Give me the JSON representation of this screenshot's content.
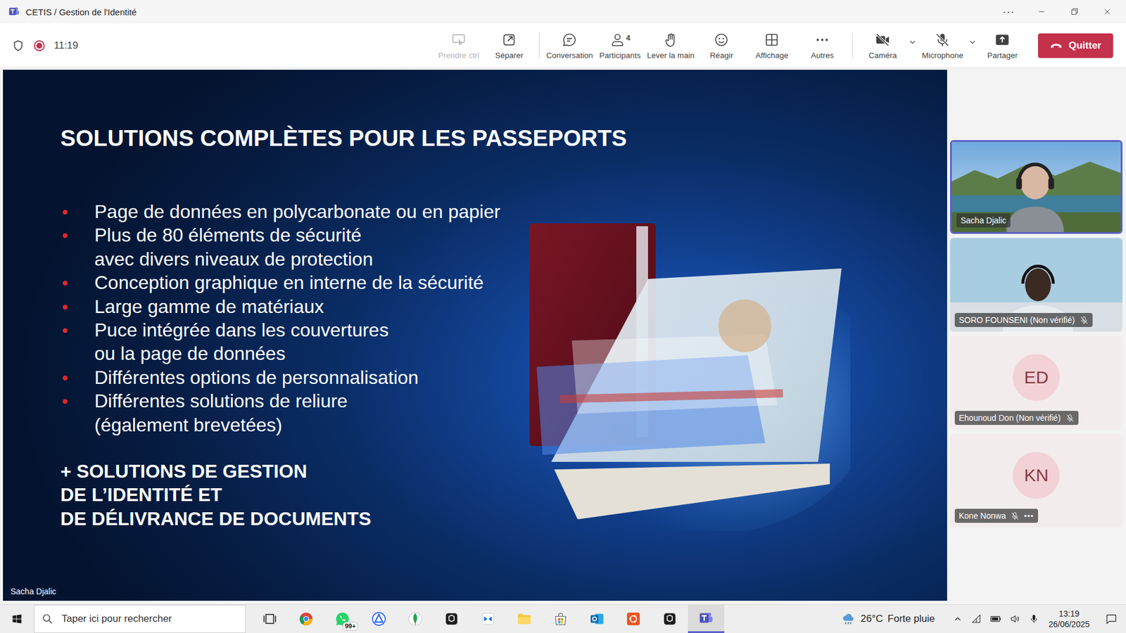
{
  "window": {
    "title": "CETIS / Gestion de l'Identité",
    "menu": "···"
  },
  "meeting": {
    "timer": "11:19",
    "recording": true
  },
  "toolbar": {
    "buttons": [
      {
        "label": "Prendre ctrl",
        "kind": "control",
        "disabled": true
      },
      {
        "label": "Séparer",
        "kind": "popout",
        "disabled": false
      },
      {
        "label": "Conversation",
        "kind": "chat",
        "disabled": false
      },
      {
        "label": "Participants",
        "kind": "people",
        "disabled": false,
        "count": "4"
      },
      {
        "label": "Lever la main",
        "kind": "hand",
        "disabled": false
      },
      {
        "label": "Réagir",
        "kind": "react",
        "disabled": false
      },
      {
        "label": "Affichage",
        "kind": "view",
        "disabled": false
      },
      {
        "label": "Autres",
        "kind": "more",
        "disabled": false
      }
    ],
    "devices": [
      {
        "label": "Caméra",
        "kind": "camera",
        "on": false
      },
      {
        "label": "Microphone",
        "kind": "mic",
        "on": false
      },
      {
        "label": "Partager",
        "kind": "share",
        "on": false
      }
    ],
    "leave": {
      "label": "Quitter"
    }
  },
  "slide": {
    "title": "SOLUTIONS COMPLÈTES POUR LES PASSEPORTS",
    "bullets": [
      [
        "Page de données en polycarbonate ou en papier"
      ],
      [
        "Plus de 80 éléments de sécurité",
        "avec divers niveaux de protection"
      ],
      [
        "Conception graphique en interne de la sécurité"
      ],
      [
        "Large gamme de matériaux"
      ],
      [
        "Puce intégrée dans les couvertures",
        "ou la page de données"
      ],
      [
        "Différentes options de personnalisation"
      ],
      [
        "Différentes solutions de reliure",
        "(également brevetées)"
      ]
    ],
    "footer": [
      "+ SOLUTIONS DE GESTION",
      "DE L’IDENTITÉ ET",
      "DE DÉLIVRANCE DE DOCUMENTS"
    ],
    "presenter": "Sacha Djalic"
  },
  "participants": [
    {
      "name": "Sacha Djalic",
      "kind": "video",
      "selected": true,
      "muted": false
    },
    {
      "name": "SORO FOUNSENI (Non vérifié)",
      "kind": "video",
      "selected": false,
      "muted": true
    },
    {
      "name": "Ehounoud Don (Non vérifié)",
      "kind": "avatar",
      "initials": "ED",
      "selected": false,
      "muted": true
    },
    {
      "name": "Kone Nonwa",
      "kind": "avatar",
      "initials": "KN",
      "selected": false,
      "muted": true,
      "more": "•••"
    }
  ],
  "taskbar": {
    "search": {
      "placeholder": "Taper ici pour rechercher"
    },
    "apps": [
      {
        "kind": "taskview",
        "selected": false
      },
      {
        "kind": "chrome",
        "selected": false
      },
      {
        "kind": "whatsapp",
        "selected": false,
        "badge": "99+"
      },
      {
        "kind": "triangle",
        "selected": false
      },
      {
        "kind": "leaf",
        "selected": false
      },
      {
        "kind": "blackbox",
        "selected": false
      },
      {
        "kind": "bluebox",
        "selected": false
      },
      {
        "kind": "folder",
        "selected": false
      },
      {
        "kind": "store",
        "selected": false
      },
      {
        "kind": "outlook",
        "selected": false
      },
      {
        "kind": "ubuntu",
        "selected": false
      },
      {
        "kind": "blackbox",
        "selected": false
      },
      {
        "kind": "teams",
        "selected": true
      }
    ],
    "weather": {
      "temp": "26°C",
      "text": "Forte pluie"
    },
    "time": "13:19",
    "date": "26/06/2025"
  }
}
